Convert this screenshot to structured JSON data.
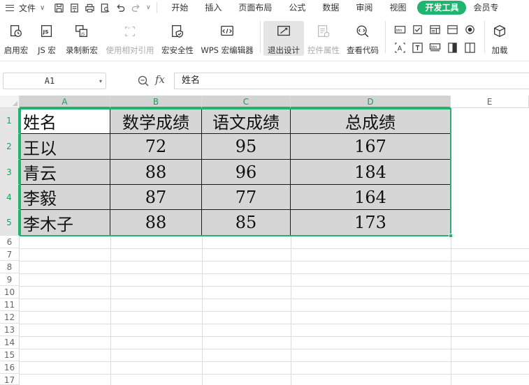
{
  "menu": {
    "file_label": "文件",
    "tabs": [
      {
        "label": "开始",
        "active": false
      },
      {
        "label": "插入",
        "active": false
      },
      {
        "label": "页面布局",
        "active": false
      },
      {
        "label": "公式",
        "active": false
      },
      {
        "label": "数据",
        "active": false
      },
      {
        "label": "审阅",
        "active": false
      },
      {
        "label": "视图",
        "active": false
      },
      {
        "label": "开发工具",
        "active": true
      },
      {
        "label": "会员专",
        "active": false
      }
    ]
  },
  "ribbon": {
    "buttons": [
      {
        "label": "启用宏",
        "icon": "macro-clock-icon",
        "disabled": false
      },
      {
        "label": "JS 宏",
        "icon": "js-macro-icon",
        "disabled": false
      },
      {
        "label": "录制新宏",
        "icon": "record-macro-icon",
        "disabled": false
      },
      {
        "label": "使用相对引用",
        "icon": "relative-reference-icon",
        "disabled": true
      },
      {
        "label": "宏安全性",
        "icon": "macro-security-icon",
        "disabled": false
      },
      {
        "label": "WPS 宏编辑器",
        "icon": "macro-editor-icon",
        "disabled": false
      },
      {
        "label": "退出设计",
        "icon": "design-mode-icon",
        "disabled": false,
        "pressed": true
      },
      {
        "label": "控件属性",
        "icon": "control-properties-icon",
        "disabled": true
      },
      {
        "label": "查看代码",
        "icon": "view-code-icon",
        "disabled": false
      },
      {
        "label": "加载",
        "icon": "addin-cube-icon",
        "disabled": false
      }
    ]
  },
  "formula_bar": {
    "name_box": "A1",
    "fx": "fx",
    "value": "姓名"
  },
  "sheet": {
    "columns": [
      "A",
      "B",
      "C",
      "D",
      "E"
    ],
    "rows": [
      "1",
      "2",
      "3",
      "4",
      "5",
      "6",
      "7",
      "8",
      "9",
      "10",
      "11",
      "12",
      "13",
      "14",
      "15",
      "16",
      "17"
    ],
    "table": [
      [
        "姓名",
        "数学成绩",
        "语文成绩",
        "总成绩"
      ],
      [
        "王以",
        "72",
        "95",
        "167"
      ],
      [
        "青云",
        "88",
        "96",
        "184"
      ],
      [
        "李毅",
        "87",
        "77",
        "164"
      ],
      [
        "李木子",
        "88",
        "85",
        "173"
      ]
    ]
  },
  "colors": {
    "accent": "#1fb56f",
    "selection_fill": "#d6d6d6"
  }
}
